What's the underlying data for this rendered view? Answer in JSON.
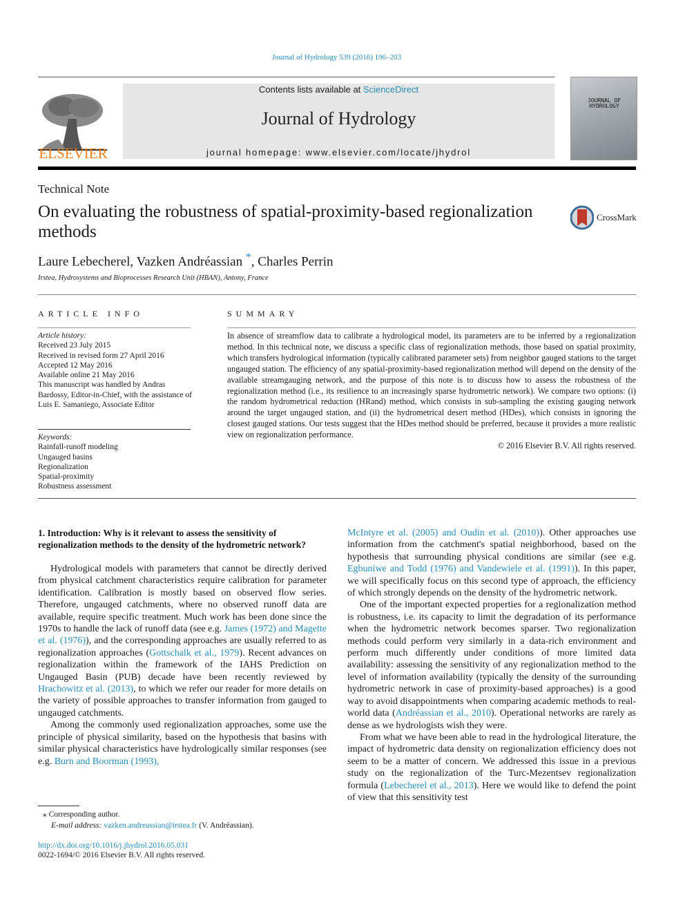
{
  "header": {
    "citation": "Journal of Hydrology 539 (2016) 196–203",
    "publisher_logo": "ELSEVIER",
    "contents_prefix": "Contents lists available at ",
    "contents_link": "ScienceDirect",
    "journal_title": "Journal of Hydrology",
    "homepage": "journal homepage: www.elsevier.com/locate/jhydrol",
    "cover_title_line1": "JOURNAL OF",
    "cover_title_line2": "HYDROLOGY"
  },
  "article": {
    "type": "Technical Note",
    "title": "On evaluating the robustness of spatial-proximity-based regionalization methods",
    "crossmark_label": "CrossMark",
    "authors_part1": "Laure Lebecherel, Vazken Andréassian",
    "author_star": "*",
    "authors_part2": ", Charles Perrin",
    "affiliation": "Irstea, Hydrosystems and Bioprocesses Research Unit (HBAN), Antony, France"
  },
  "article_info": {
    "heading": "ARTICLE INFO",
    "history_label": "Article history:",
    "history": [
      "Received 23 July 2015",
      "Received in revised form 27 April 2016",
      "Accepted 12 May 2016",
      "Available online 21 May 2016",
      "This manuscript was handled by Andras Bardossy, Editor-in-Chief, with the assistance of Luis E. Samaniego, Associate Editor"
    ],
    "keywords_label": "Keywords:",
    "keywords": [
      "Rainfall-runoff modeling",
      "Ungauged basins",
      "Regionalization",
      "Spatial-proximity",
      "Robustness assessment"
    ]
  },
  "summary": {
    "heading": "SUMMARY",
    "text": "In absence of streamflow data to calibrate a hydrological model, its parameters are to be inferred by a regionalization method. In this technical note, we discuss a specific class of regionalization methods, those based on spatial proximity, which transfers hydrological information (typically calibrated parameter sets) from neighbor gauged stations to the target ungauged station. The efficiency of any spatial-proximity-based regionalization method will depend on the density of the available streamgauging network, and the purpose of this note is to discuss how to assess the robustness of the regionalization method (i.e., its resilience to an increasingly sparse hydrometric network). We compare two options: (i) the random hydrometrical reduction (HRand) method, which consists in sub-sampling the existing gauging network around the target ungauged station, and (ii) the hydrometrical desert method (HDes), which consists in ignoring the closest gauged stations. Our tests suggest that the HDes method should be preferred, because it provides a more realistic view on regionalization performance.",
    "copyright": "© 2016 Elsevier B.V. All rights reserved."
  },
  "body": {
    "section_heading": "1. Introduction: Why is it relevant to assess the sensitivity of regionalization methods to the density of the hydrometric network?",
    "left_p1": [
      {
        "t": "Hydrological models with parameters that cannot be directly derived from physical catchment characteristics require calibration for parameter identification. Calibration is mostly based on observed flow series. Therefore, ungauged catchments, where no observed runoff data are available, require specific treatment. Much work has been done since the 1970s to handle the lack of runoff data (see e.g. "
      },
      {
        "link": "James (1972) and Magette et al. (1976)"
      },
      {
        "t": "), and the corresponding approaches are usually referred to as regionalization approaches ("
      },
      {
        "link": "Gottschalk et al., 1979"
      },
      {
        "t": "). Recent advances on regionalization within the framework of the IAHS Prediction on Ungauged Basin (PUB) decade have been recently reviewed by "
      },
      {
        "link": "Hrachowitz et al. (2013)"
      },
      {
        "t": ", to which we refer our reader for more details on the variety of possible approaches to transfer information from gauged to ungauged catchments."
      }
    ],
    "left_p2": [
      {
        "t": "Among the commonly used regionalization approaches, some use the principle of physical similarity, based on the hypothesis that basins with similar physical characteristics have hydrologically similar responses (see e.g. "
      },
      {
        "link": "Burn and Boorman (1993),"
      }
    ],
    "right_p1": [
      {
        "link": "McIntyre et al. (2005) and Oudin et al. (2010)"
      },
      {
        "t": "). Other approaches use information from the catchment's spatial neighborhood, based on the hypothesis that surrounding physical conditions are similar (see e.g. "
      },
      {
        "link": "Egbuniwe and Todd (1976) and Vandewiele et al. (1991)"
      },
      {
        "t": "). In this paper, we will specifically focus on this second type of approach, the efficiency of which strongly depends on the density of the hydrometric network."
      }
    ],
    "right_p2": [
      {
        "t": "One of the important expected properties for a regionalization method is robustness, i.e. its capacity to limit the degradation of its performance when the hydrometric network becomes sparser. Two regionalization methods could perform very similarly in a data-rich environment and perform much differently under conditions of more limited data availability: assessing the sensitivity of any regionalization method to the level of information availability (typically the density of the surrounding hydrometric network in case of proximity-based approaches) is a good way to avoid disappointments when comparing academic methods to real-world data ("
      },
      {
        "link": "Andréassian et al., 2010"
      },
      {
        "t": "). Operational networks are rarely as dense as we hydrologists wish they were."
      }
    ],
    "right_p3": [
      {
        "t": "From what we have been able to read in the hydrological literature, the impact of hydrometric data density on regionalization efficiency does not seem to be a matter of concern. We addressed this issue in a previous study on the regionalization of the Turc-Mezentsev regionalization formula ("
      },
      {
        "link": "Lebecherel et al., 2013"
      },
      {
        "t": "). Here we would like to defend the point of view that this sensitivity test"
      }
    ]
  },
  "footnote": {
    "star_line": "⁎ Corresponding author.",
    "email_label": "E-mail address: ",
    "email": "vazken.andreassian@irstea.fr",
    "email_suffix": " (V. Andréassian).",
    "doi": "http://dx.doi.org/10.1016/j.jhydrol.2016.05.031",
    "issn": "0022-1694/© 2016 Elsevier B.V. All rights reserved."
  },
  "colors": {
    "link": "#2a8bb8",
    "elsevier_orange": "#f07f1c",
    "banner_bg": "#e6e6e6"
  }
}
